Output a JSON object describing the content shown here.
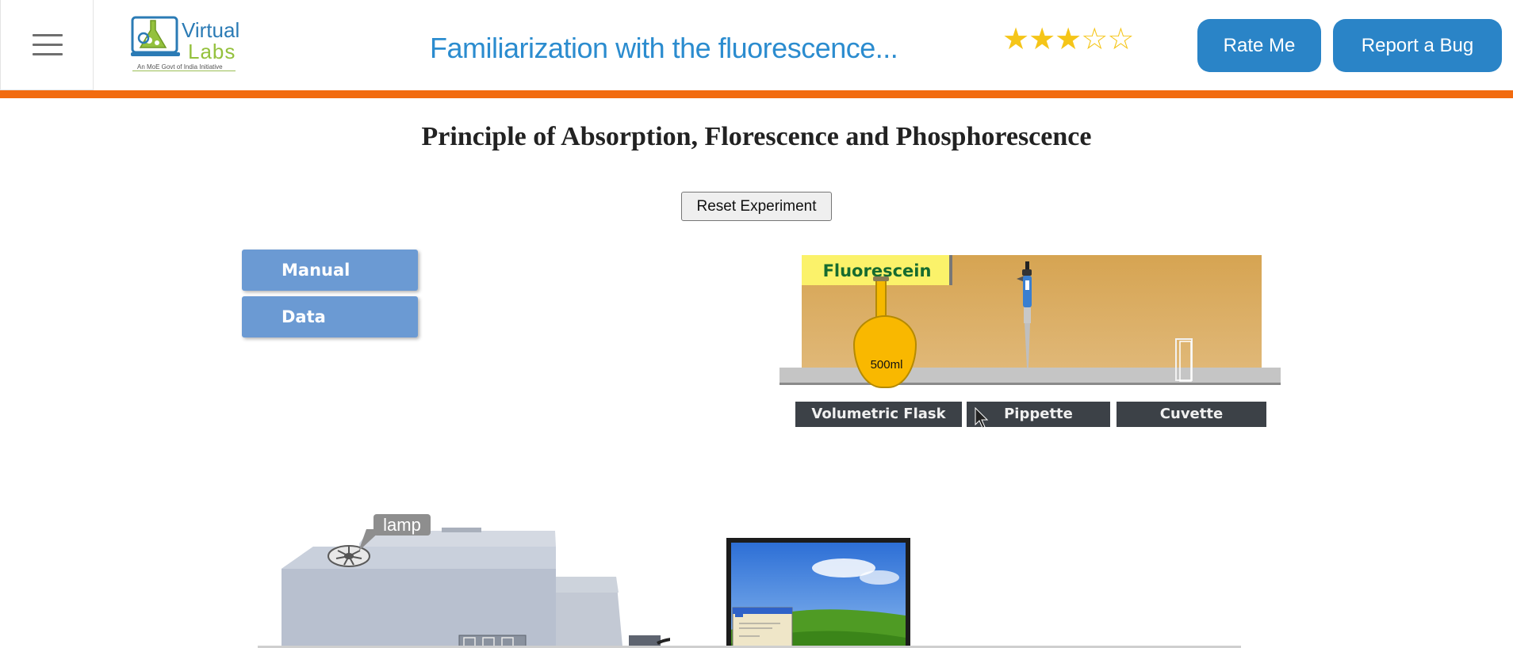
{
  "header": {
    "logo_line1": "Virtual",
    "logo_line2": "Labs",
    "logo_tagline": "An MoE Govt of India Initiative",
    "experiment_title": "Familiarization with the fluorescence...",
    "rating": {
      "value": 3,
      "max": 5
    },
    "rate_button": "Rate Me",
    "bug_button": "Report a Bug"
  },
  "main": {
    "heading": "Principle of Absorption, Florescence and Phosphorescence",
    "reset_button": "Reset Experiment",
    "side_buttons": {
      "manual": "Manual",
      "data": "Data"
    }
  },
  "shelf": {
    "chemical_label": "Fluorescein",
    "flask_volume": "500ml",
    "trays": {
      "flask": "Volumetric Flask",
      "pipette": "Pippette",
      "cuvette": "Cuvette"
    }
  },
  "instrument": {
    "lamp_label": "lamp"
  },
  "colors": {
    "brand_blue": "#2a84c7",
    "title_blue": "#2b8ccf",
    "accent_orange": "#f26b0f",
    "star_gold": "#f5c518",
    "side_button": "#6b9ad3"
  }
}
